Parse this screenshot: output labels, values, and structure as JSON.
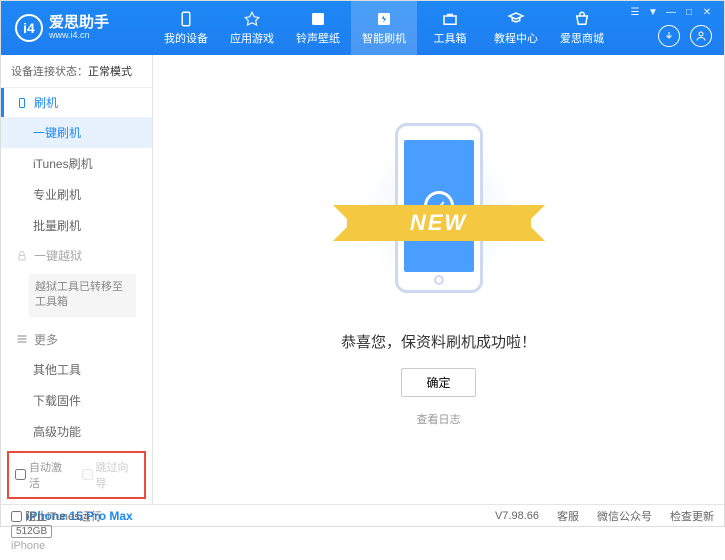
{
  "app": {
    "title": "爱思助手",
    "url": "www.i4.cn"
  },
  "nav": [
    {
      "label": "我的设备"
    },
    {
      "label": "应用游戏"
    },
    {
      "label": "铃声壁纸"
    },
    {
      "label": "智能刷机"
    },
    {
      "label": "工具箱"
    },
    {
      "label": "教程中心"
    },
    {
      "label": "爱思商城"
    }
  ],
  "status": {
    "prefix": "设备连接状态：",
    "value": "正常模式"
  },
  "sidebar": {
    "group_flash": "刷机",
    "items_flash": [
      "一键刷机",
      "iTunes刷机",
      "专业刷机",
      "批量刷机"
    ],
    "group_jailbreak": "一键越狱",
    "jailbreak_note": "越狱工具已转移至工具箱",
    "group_more": "更多",
    "items_more": [
      "其他工具",
      "下载固件",
      "高级功能"
    ],
    "auto_activate": "自动激活",
    "skip_guide": "跳过向导"
  },
  "device": {
    "name": "iPhone 15 Pro Max",
    "storage": "512GB",
    "type": "iPhone"
  },
  "main": {
    "ribbon": "NEW",
    "message": "恭喜您，保资料刷机成功啦！",
    "confirm": "确定",
    "view_log": "查看日志"
  },
  "footer": {
    "block_itunes": "阻止iTunes运行",
    "version": "V7.98.66",
    "links": [
      "客服",
      "微信公众号",
      "检查更新"
    ]
  }
}
